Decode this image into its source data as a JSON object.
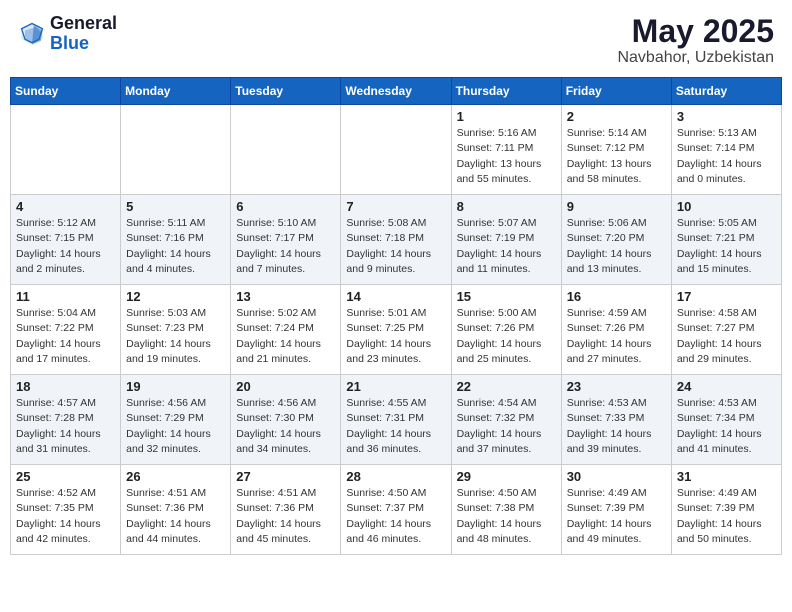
{
  "header": {
    "logo_general": "General",
    "logo_blue": "Blue",
    "month": "May 2025",
    "location": "Navbahor, Uzbekistan"
  },
  "days_of_week": [
    "Sunday",
    "Monday",
    "Tuesday",
    "Wednesday",
    "Thursday",
    "Friday",
    "Saturday"
  ],
  "weeks": [
    [
      {
        "day": "",
        "detail": ""
      },
      {
        "day": "",
        "detail": ""
      },
      {
        "day": "",
        "detail": ""
      },
      {
        "day": "",
        "detail": ""
      },
      {
        "day": "1",
        "detail": "Sunrise: 5:16 AM\nSunset: 7:11 PM\nDaylight: 13 hours\nand 55 minutes."
      },
      {
        "day": "2",
        "detail": "Sunrise: 5:14 AM\nSunset: 7:12 PM\nDaylight: 13 hours\nand 58 minutes."
      },
      {
        "day": "3",
        "detail": "Sunrise: 5:13 AM\nSunset: 7:14 PM\nDaylight: 14 hours\nand 0 minutes."
      }
    ],
    [
      {
        "day": "4",
        "detail": "Sunrise: 5:12 AM\nSunset: 7:15 PM\nDaylight: 14 hours\nand 2 minutes."
      },
      {
        "day": "5",
        "detail": "Sunrise: 5:11 AM\nSunset: 7:16 PM\nDaylight: 14 hours\nand 4 minutes."
      },
      {
        "day": "6",
        "detail": "Sunrise: 5:10 AM\nSunset: 7:17 PM\nDaylight: 14 hours\nand 7 minutes."
      },
      {
        "day": "7",
        "detail": "Sunrise: 5:08 AM\nSunset: 7:18 PM\nDaylight: 14 hours\nand 9 minutes."
      },
      {
        "day": "8",
        "detail": "Sunrise: 5:07 AM\nSunset: 7:19 PM\nDaylight: 14 hours\nand 11 minutes."
      },
      {
        "day": "9",
        "detail": "Sunrise: 5:06 AM\nSunset: 7:20 PM\nDaylight: 14 hours\nand 13 minutes."
      },
      {
        "day": "10",
        "detail": "Sunrise: 5:05 AM\nSunset: 7:21 PM\nDaylight: 14 hours\nand 15 minutes."
      }
    ],
    [
      {
        "day": "11",
        "detail": "Sunrise: 5:04 AM\nSunset: 7:22 PM\nDaylight: 14 hours\nand 17 minutes."
      },
      {
        "day": "12",
        "detail": "Sunrise: 5:03 AM\nSunset: 7:23 PM\nDaylight: 14 hours\nand 19 minutes."
      },
      {
        "day": "13",
        "detail": "Sunrise: 5:02 AM\nSunset: 7:24 PM\nDaylight: 14 hours\nand 21 minutes."
      },
      {
        "day": "14",
        "detail": "Sunrise: 5:01 AM\nSunset: 7:25 PM\nDaylight: 14 hours\nand 23 minutes."
      },
      {
        "day": "15",
        "detail": "Sunrise: 5:00 AM\nSunset: 7:26 PM\nDaylight: 14 hours\nand 25 minutes."
      },
      {
        "day": "16",
        "detail": "Sunrise: 4:59 AM\nSunset: 7:26 PM\nDaylight: 14 hours\nand 27 minutes."
      },
      {
        "day": "17",
        "detail": "Sunrise: 4:58 AM\nSunset: 7:27 PM\nDaylight: 14 hours\nand 29 minutes."
      }
    ],
    [
      {
        "day": "18",
        "detail": "Sunrise: 4:57 AM\nSunset: 7:28 PM\nDaylight: 14 hours\nand 31 minutes."
      },
      {
        "day": "19",
        "detail": "Sunrise: 4:56 AM\nSunset: 7:29 PM\nDaylight: 14 hours\nand 32 minutes."
      },
      {
        "day": "20",
        "detail": "Sunrise: 4:56 AM\nSunset: 7:30 PM\nDaylight: 14 hours\nand 34 minutes."
      },
      {
        "day": "21",
        "detail": "Sunrise: 4:55 AM\nSunset: 7:31 PM\nDaylight: 14 hours\nand 36 minutes."
      },
      {
        "day": "22",
        "detail": "Sunrise: 4:54 AM\nSunset: 7:32 PM\nDaylight: 14 hours\nand 37 minutes."
      },
      {
        "day": "23",
        "detail": "Sunrise: 4:53 AM\nSunset: 7:33 PM\nDaylight: 14 hours\nand 39 minutes."
      },
      {
        "day": "24",
        "detail": "Sunrise: 4:53 AM\nSunset: 7:34 PM\nDaylight: 14 hours\nand 41 minutes."
      }
    ],
    [
      {
        "day": "25",
        "detail": "Sunrise: 4:52 AM\nSunset: 7:35 PM\nDaylight: 14 hours\nand 42 minutes."
      },
      {
        "day": "26",
        "detail": "Sunrise: 4:51 AM\nSunset: 7:36 PM\nDaylight: 14 hours\nand 44 minutes."
      },
      {
        "day": "27",
        "detail": "Sunrise: 4:51 AM\nSunset: 7:36 PM\nDaylight: 14 hours\nand 45 minutes."
      },
      {
        "day": "28",
        "detail": "Sunrise: 4:50 AM\nSunset: 7:37 PM\nDaylight: 14 hours\nand 46 minutes."
      },
      {
        "day": "29",
        "detail": "Sunrise: 4:50 AM\nSunset: 7:38 PM\nDaylight: 14 hours\nand 48 minutes."
      },
      {
        "day": "30",
        "detail": "Sunrise: 4:49 AM\nSunset: 7:39 PM\nDaylight: 14 hours\nand 49 minutes."
      },
      {
        "day": "31",
        "detail": "Sunrise: 4:49 AM\nSunset: 7:39 PM\nDaylight: 14 hours\nand 50 minutes."
      }
    ]
  ]
}
